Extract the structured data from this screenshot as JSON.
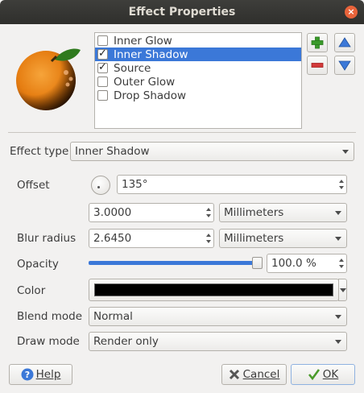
{
  "window": {
    "title": "Effect Properties",
    "close_glyph": "×"
  },
  "effects": [
    {
      "label": "Inner Glow",
      "checked": false,
      "selected": false
    },
    {
      "label": "Inner Shadow",
      "checked": true,
      "selected": true
    },
    {
      "label": "Source",
      "checked": true,
      "selected": false
    },
    {
      "label": "Outer Glow",
      "checked": false,
      "selected": false
    },
    {
      "label": "Drop Shadow",
      "checked": false,
      "selected": false
    }
  ],
  "effect_type": {
    "label": "Effect type",
    "value": "Inner Shadow"
  },
  "offset": {
    "label": "Offset",
    "angle": "135°",
    "distance": "3.0000",
    "unit": "Millimeters"
  },
  "blur": {
    "label": "Blur radius",
    "value": "2.6450",
    "unit": "Millimeters"
  },
  "opacity": {
    "label": "Opacity",
    "value": "100.0 %",
    "level": 1.0
  },
  "color": {
    "label": "Color",
    "value": "#000000"
  },
  "blend_mode": {
    "label": "Blend mode",
    "value": "Normal"
  },
  "draw_mode": {
    "label": "Draw mode",
    "value": "Render only"
  },
  "buttons": {
    "help": "Help",
    "cancel": "Cancel",
    "ok": "OK"
  },
  "colors": {
    "selection": "#3b78d8",
    "add_green": "#3a9a2a",
    "remove_red": "#d23a3a",
    "arrow_blue": "#3b78d8"
  }
}
